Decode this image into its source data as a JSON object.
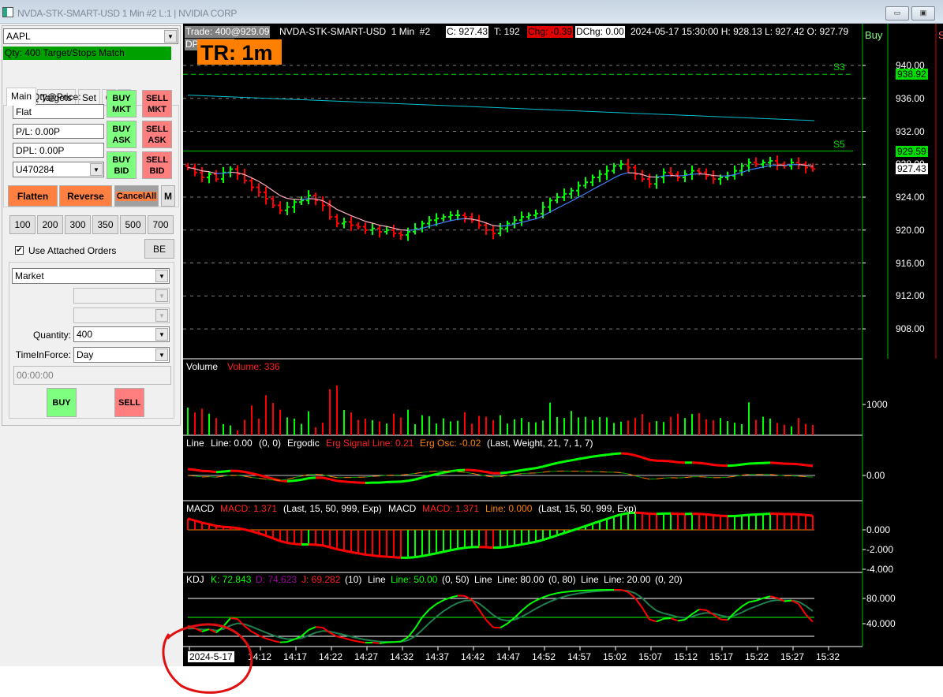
{
  "window": {
    "title": "NVDA-STK-SMART-USD  1 Min  #2 L:1 | NVIDIA CORP",
    "minimize": "▭",
    "restore": "▣"
  },
  "order_panel": {
    "symbol": "AAPL",
    "status": "Qty: 400 Target/Stops Match",
    "tabs": [
      "Main",
      "Targets",
      "Set",
      "C",
      "A"
    ],
    "pos_label": "Pos Qty@Price:",
    "position": "Flat",
    "pl": "P/L: 0.00P",
    "dpl": "DPL: 0.00P",
    "account": "U470284",
    "buy_mkt": [
      "BUY",
      "MKT"
    ],
    "buy_ask": [
      "BUY",
      "ASK"
    ],
    "buy_bid": [
      "BUY",
      "BID"
    ],
    "sell_mkt": [
      "SELL",
      "MKT"
    ],
    "sell_ask": [
      "SELL",
      "ASK"
    ],
    "sell_bid": [
      "SELL",
      "BID"
    ],
    "flatten": "Flatten",
    "reverse": "Reverse",
    "cancel_all": "CancelAll",
    "m": "M",
    "qty_presets": [
      "100",
      "200",
      "300",
      "350",
      "500",
      "700"
    ],
    "use_attached": "Use Attached Orders",
    "use_attached_checked": true,
    "be": "BE",
    "order_type": "Market",
    "quantity_label": "Quantity:",
    "quantity": "400",
    "tif_label": "TimeInForce:",
    "tif": "Day",
    "time": "00:00:00",
    "buy": "BUY",
    "sell": "SELL"
  },
  "header": {
    "trade": "Trade: 400@929.09",
    "dpl": "DPL: 0.00P",
    "symbol": "NVDA-STK-SMART-USD  1 Min  #2",
    "close": "C: 927.43",
    "ticks": "T: 192",
    "chg": "Chg: -0.39",
    "dchg": "DChg: 0.00",
    "ohlc": "2024-05-17 15:30:00 H: 928.13 L: 927.42 O: 927.79",
    "tr": "TR: 1m",
    "buy": "Buy",
    "s": "S"
  },
  "colors": {
    "up": "#00ff00",
    "down": "#ff0000",
    "ma_up": "#4080ff",
    "ma_down": "#ffb0c0",
    "cyan": "#00c0d0"
  },
  "chart_data": {
    "type": "candlestick",
    "start_time": "14:02",
    "interval_min": 1,
    "close": [
      927.6,
      927.0,
      926.4,
      926.8,
      926.2,
      927.0,
      927.4,
      926.8,
      926.0,
      925.2,
      924.6,
      923.8,
      923.0,
      922.4,
      922.8,
      923.4,
      923.6,
      924.2,
      923.6,
      923.0,
      921.6,
      920.8,
      921.0,
      920.6,
      920.4,
      920.0,
      920.2,
      919.8,
      920.0,
      919.6,
      919.4,
      919.8,
      920.2,
      920.8,
      921.2,
      921.4,
      921.6,
      921.8,
      921.8,
      921.6,
      921.2,
      920.6,
      920.0,
      919.6,
      920.2,
      920.8,
      921.2,
      921.6,
      921.8,
      922.0,
      922.8,
      923.6,
      924.0,
      924.4,
      924.8,
      925.4,
      925.8,
      926.4,
      926.8,
      927.2,
      927.8,
      928.0,
      927.6,
      926.8,
      926.2,
      925.6,
      926.4,
      927.0,
      926.8,
      926.4,
      926.8,
      927.2,
      927.0,
      926.6,
      926.2,
      926.4,
      926.6,
      927.2,
      927.8,
      928.2,
      928.0,
      928.2,
      928.4,
      928.0,
      927.8,
      928.2,
      928.0,
      927.6,
      927.43
    ],
    "volume": [
      900,
      740,
      860,
      700,
      560,
      360,
      320,
      160,
      500,
      970,
      540,
      1300,
      1050,
      830,
      580,
      540,
      370,
      780,
      260,
      410,
      1500,
      1620,
      820,
      740,
      500,
      540,
      490,
      450,
      380,
      700,
      580,
      830,
      360,
      650,
      620,
      380,
      550,
      450,
      470,
      750,
      380,
      630,
      600,
      490,
      650,
      380,
      520,
      560,
      430,
      420,
      480,
      1060,
      590,
      560,
      790,
      580,
      600,
      490,
      590,
      580,
      400,
      440,
      480,
      570,
      690,
      420,
      460,
      430,
      600,
      700,
      560,
      690,
      720,
      520,
      490,
      560,
      460,
      410,
      360,
      1070,
      500,
      600,
      540,
      400,
      340,
      290,
      560,
      370,
      336
    ],
    "price_ticks": [
      "940.00",
      "936.00",
      "932.00",
      "928.00",
      "924.00",
      "920.00",
      "916.00",
      "912.00",
      "908.00"
    ],
    "price_tick_values": [
      940,
      936,
      932,
      928,
      924,
      920,
      916,
      912,
      908
    ],
    "price_ylim": [
      905,
      942
    ],
    "levels": [
      {
        "name": "S3",
        "price": 938.92,
        "tag": "938.92",
        "style": "dashed"
      },
      {
        "name": "S5",
        "price": 929.59,
        "tag": "929.59",
        "style": "solid"
      }
    ],
    "last_tag": "927.43",
    "trendline": [
      936.4,
      933.3
    ],
    "time_ticks": [
      "2024-5-17",
      "14:12",
      "14:17",
      "14:22",
      "14:27",
      "14:32",
      "14:37",
      "14:42",
      "14:47",
      "14:52",
      "14:57",
      "15:02",
      "15:07",
      "15:12",
      "15:17",
      "15:22",
      "15:27",
      "15:32"
    ],
    "volume_pane": {
      "title": "Volume",
      "value": "Volume: 336",
      "ticks": [
        "1000"
      ]
    },
    "ergodic_pane": {
      "t1": "Line",
      "t2": "Line: 0.00",
      "t3": "(0, 0)",
      "t4": "Ergodic",
      "t5": "Erg Signal Line: 0.21",
      "t6": "Erg Osc: -0.02",
      "t7": "(Last, Weight, 21, 7, 1, 7)",
      "ticks": [
        "0.00"
      ]
    },
    "macd_pane": {
      "t1": "MACD",
      "t2": "MACD: 1.371",
      "t3": "(Last, 15, 50, 999, Exp)",
      "t4": "MACD",
      "t5": "MACD: 1.371",
      "t6": "Line: 0.000",
      "t7": "(Last, 15, 50, 999, Exp)",
      "ticks": [
        "0.000",
        "-2.000",
        "-4.000"
      ]
    },
    "kdj_pane": {
      "t1": "KDJ",
      "t2": "K: 72.843",
      "t3": "D: 74.623",
      "t4": "J: 69.282",
      "t5": "(10)",
      "t6": "Line",
      "t7": "Line: 50.00",
      "t8": "(0, 50)",
      "t9": "Line",
      "t10": "Line: 80.00",
      "t11": "(0, 80)",
      "t12": "Line",
      "t13": "Line: 20.00",
      "t14": "(0, 20)",
      "ticks": [
        "80.000",
        "40.000"
      ]
    }
  }
}
